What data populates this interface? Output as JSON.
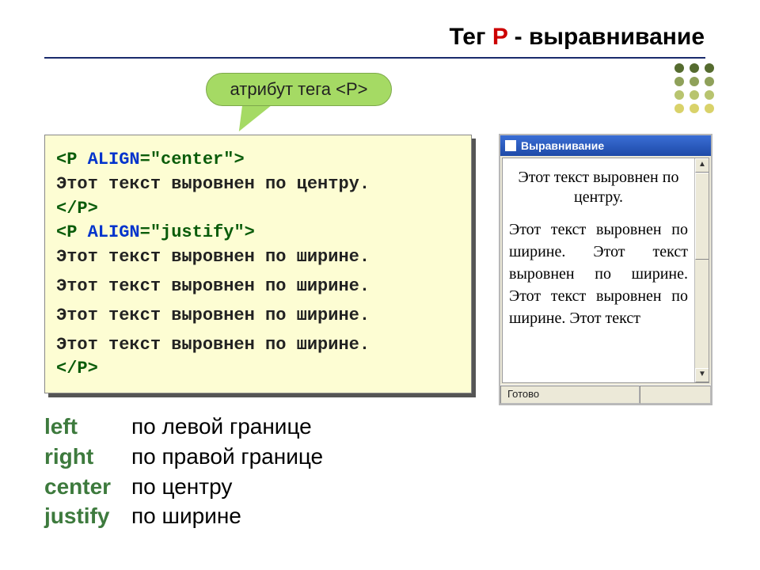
{
  "heading": {
    "prefix": "Тег ",
    "letter": "P",
    "suffix": " - выравнивание"
  },
  "callout": "атрибут тега <P>",
  "code": {
    "l1a": "<P ",
    "l1b": "ALIGN",
    "l1c": "=\"center\">",
    "l2": "Этот текст выровнен по центру.",
    "l3": "</P>",
    "l4a": "<P ",
    "l4b": "ALIGN",
    "l4c": "=\"justify\">",
    "l5": "Этот текст выровнен по ширине.",
    "l6": "Этот текст выровнен по ширине.",
    "l7": "Этот текст выровнен по ширине.",
    "l8": "Этот текст выровнен по ширине.",
    "l9": "</P>"
  },
  "defs": [
    {
      "kw": "left",
      "txt": "по левой границе"
    },
    {
      "kw": "right",
      "txt": "по правой границе"
    },
    {
      "kw": "center",
      "txt": "по центру"
    },
    {
      "kw": "justify",
      "txt": "по ширине"
    }
  ],
  "preview": {
    "title": "Выравнивание",
    "p1": "Этот текст выровнен по центру.",
    "p2": "Этот текст выровнен по ширине. Этот текст выровнен по ширине. Этот текст выровнен по ширине. Этот текст",
    "status": "Готово"
  }
}
